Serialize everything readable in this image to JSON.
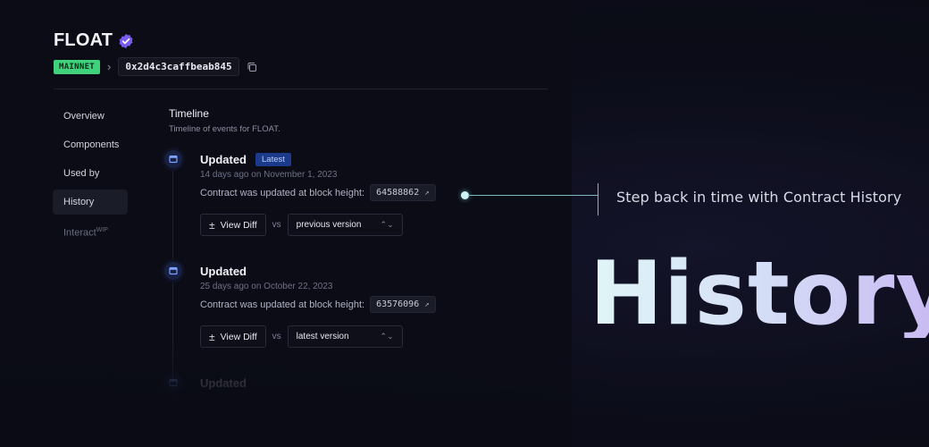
{
  "header": {
    "title": "FLOAT",
    "network": "MAINNET",
    "address": "0x2d4c3caffbeab845"
  },
  "nav": {
    "items": [
      {
        "label": "Overview"
      },
      {
        "label": "Components"
      },
      {
        "label": "Used by"
      },
      {
        "label": "History",
        "active": true
      },
      {
        "label": "Interact",
        "sup": "WIP"
      }
    ]
  },
  "timeline": {
    "title": "Timeline",
    "subtitle": "Timeline of events for FLOAT.",
    "events": [
      {
        "title": "Updated",
        "badge": "Latest",
        "time": "14 days ago on November 1, 2023",
        "description": "Contract was updated at block height:",
        "block": "64588862",
        "diff_label": "View Diff",
        "vs": "vs",
        "compare": "previous version"
      },
      {
        "title": "Updated",
        "time": "25 days ago on October 22, 2023",
        "description": "Contract was updated at block height:",
        "block": "63576096",
        "diff_label": "View Diff",
        "vs": "vs",
        "compare": "latest version"
      },
      {
        "title": "Updated",
        "time": ""
      }
    ]
  },
  "promo": {
    "callout": "Step back in time with Contract History",
    "hero": "History"
  },
  "colors": {
    "background": "#0b0c16",
    "network_badge": "#3fd17b",
    "latest_badge": "#1c3a8a",
    "verified": "#7b5cf0"
  }
}
